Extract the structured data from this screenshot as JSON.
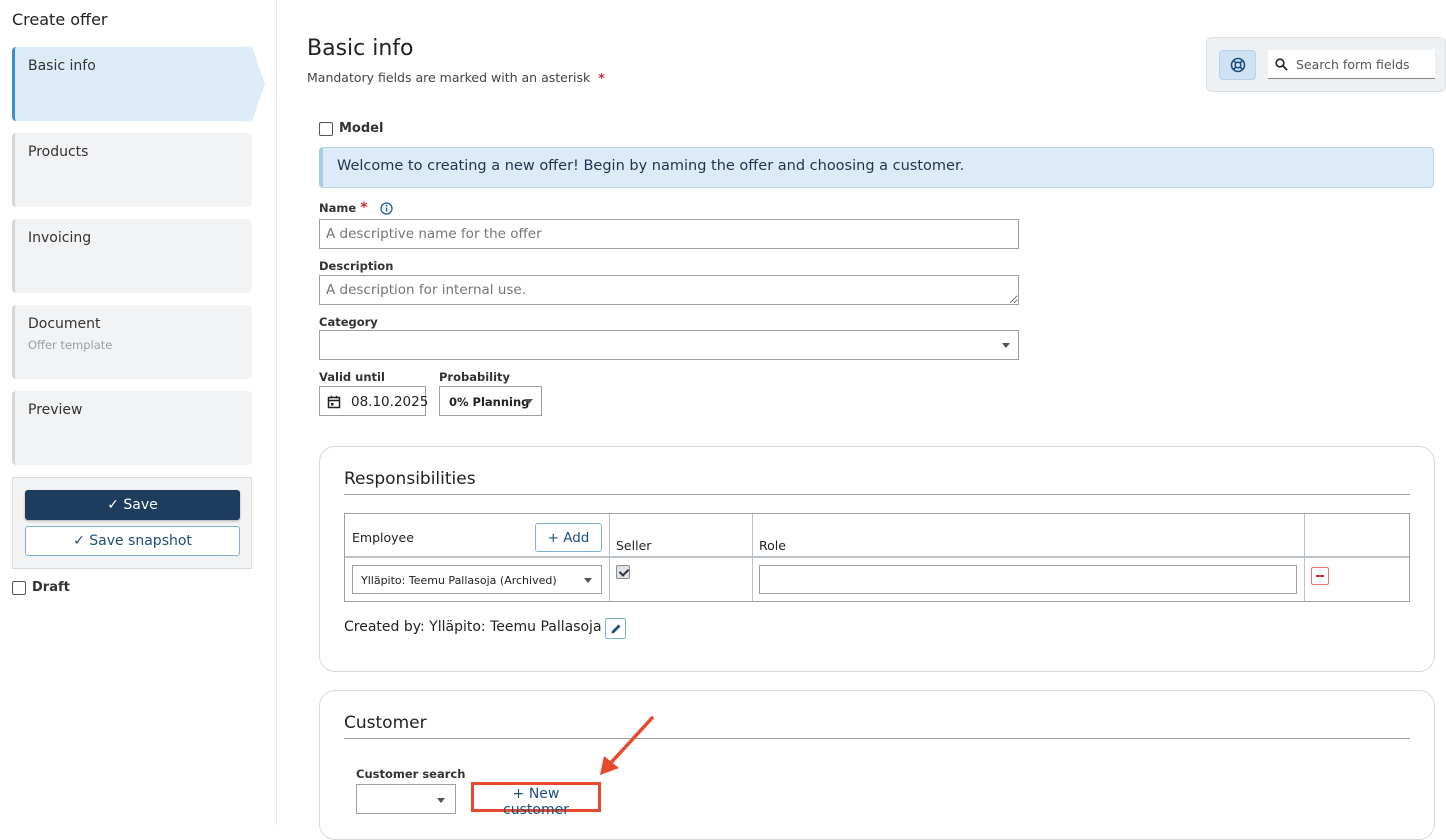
{
  "sidebar": {
    "title": "Create offer",
    "steps": [
      {
        "label": "Basic info",
        "sub": ""
      },
      {
        "label": "Products",
        "sub": ""
      },
      {
        "label": "Invoicing",
        "sub": ""
      },
      {
        "label": "Document",
        "sub": "Offer template"
      },
      {
        "label": "Preview",
        "sub": ""
      }
    ],
    "save_label": "Save",
    "save_snapshot_label": "Save snapshot",
    "draft_label": "Draft"
  },
  "header": {
    "title": "Basic info",
    "mandatory_note": "Mandatory fields are marked with an asterisk",
    "asterisk": "*",
    "search_placeholder": "Search form fields"
  },
  "form": {
    "model_label": "Model",
    "welcome_message": "Welcome to creating a new offer! Begin by naming the offer and choosing a customer.",
    "name_label": "Name",
    "name_placeholder": "A descriptive name for the offer",
    "description_label": "Description",
    "description_placeholder": "A description for internal use.",
    "category_label": "Category",
    "category_value": "",
    "valid_until_label": "Valid until",
    "valid_until_value": "08.10.2025",
    "probability_label": "Probability",
    "probability_value": "0% Planning"
  },
  "responsibilities": {
    "title": "Responsibilities",
    "columns": {
      "employee": "Employee",
      "seller": "Seller",
      "role": "Role"
    },
    "add_label": "+ Add",
    "rows": [
      {
        "employee": "Ylläpito: Teemu Pallasoja (Archived)",
        "seller": true,
        "role": ""
      }
    ],
    "created_by": "Created by: Ylläpito: Teemu Pallasoja"
  },
  "customer": {
    "title": "Customer",
    "search_label": "Customer search",
    "new_customer_label": "+ New customer"
  },
  "colors": {
    "primary_dark": "#1e3d5e",
    "accent_blue": "#3b8fd6",
    "info_bg": "#dcebf7",
    "required_red": "#d02b2b",
    "annotation_red": "#e84a2e"
  }
}
